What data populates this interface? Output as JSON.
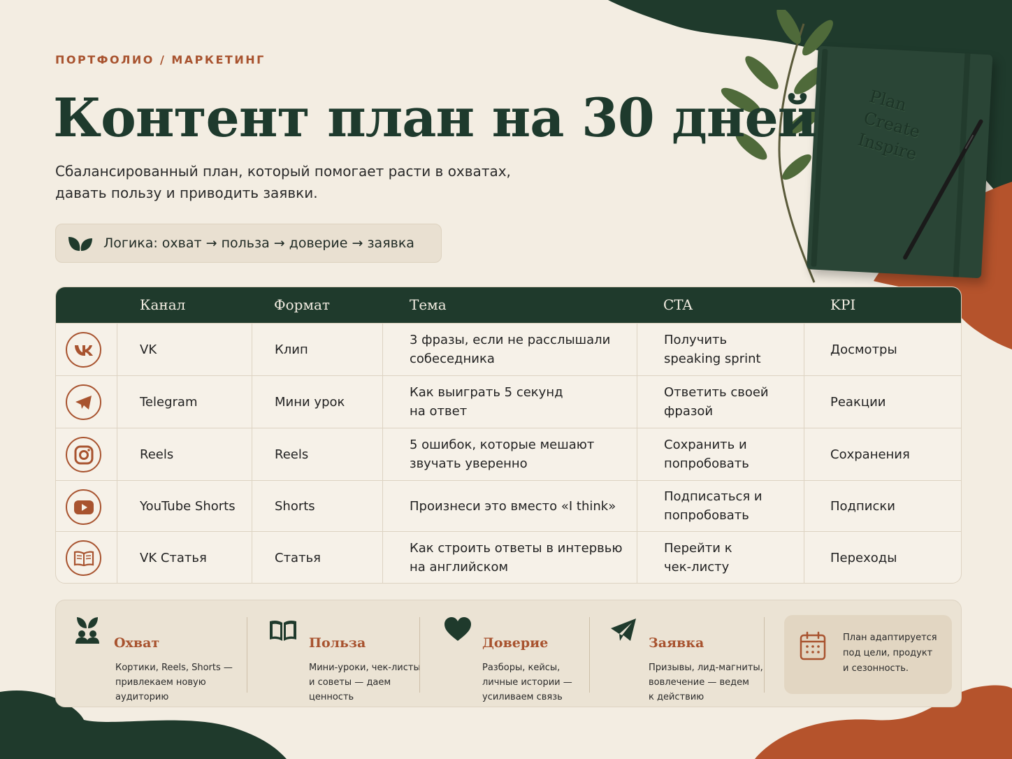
{
  "header": {
    "eyebrow": "ПОРТФОЛИО / МАРКЕТИНГ",
    "title": "Контент план на 30 дней",
    "subtitle": "Сбалансированный план, который помогает расти в охватах,\nдавать пользу и приводить заявки.",
    "logic": "Логика: охват → польза → доверие → заявка",
    "logic_icon": "leaves-icon"
  },
  "notebook": {
    "cover_text": [
      "Plan",
      "Create",
      "Inspire"
    ]
  },
  "colors": {
    "dark_green": "#1f3a2c",
    "terracotta": "#a8532f",
    "cream": "#f3ede2",
    "rust_shape": "#b5532c"
  },
  "table": {
    "headers": [
      "Канал",
      "Формат",
      "Тема",
      "CTA",
      "KPI"
    ],
    "rows": [
      {
        "icon": "vk-icon",
        "channel": "VK",
        "format": "Клип",
        "topic": "3 фразы, если не расслышали\nсобеседника",
        "cta": "Получить\nspeaking sprint",
        "kpi": "Досмотры"
      },
      {
        "icon": "telegram-icon",
        "channel": "Telegram",
        "format": "Мини урок",
        "topic": "Как выиграть 5 секунд\nна ответ",
        "cta": "Ответить своей\nфразой",
        "kpi": "Реакции"
      },
      {
        "icon": "instagram-icon",
        "channel": "Reels",
        "format": "Reels",
        "topic": "5 ошибок, которые мешают\nзвучать уверенно",
        "cta": "Сохранить и\nпопробовать",
        "kpi": "Сохранения"
      },
      {
        "icon": "youtube-icon",
        "channel": "YouTube Shorts",
        "format": "Shorts",
        "topic": "Произнеси это вместо «I think»",
        "cta": "Подписаться и\nпопробовать",
        "kpi": "Подписки"
      },
      {
        "icon": "book-icon",
        "channel": "VK Статья",
        "format": "Статья",
        "topic": "Как строить ответы в интервью\nна английском",
        "cta": "Перейти к\nчек-листу",
        "kpi": "Переходы"
      }
    ]
  },
  "pillars": [
    {
      "icon": "sprout-people-icon",
      "title": "Охват",
      "desc": "Кортики, Reels, Shorts —\nпривлекаем новую\nаудиторию"
    },
    {
      "icon": "open-book-icon",
      "title": "Польза",
      "desc": "Мини-уроки, чек-листы\nи советы — даем\nценность"
    },
    {
      "icon": "heart-icon",
      "title": "Доверие",
      "desc": "Разборы, кейсы,\nличные истории —\nусиливаем связь"
    },
    {
      "icon": "paper-plane-icon",
      "title": "Заявка",
      "desc": "Призывы, лид-магниты,\nвовлечение — ведем\nк действию"
    }
  ],
  "note": {
    "icon": "calendar-icon",
    "text": "План адаптируется\nпод цели, продукт\nи сезонность."
  }
}
